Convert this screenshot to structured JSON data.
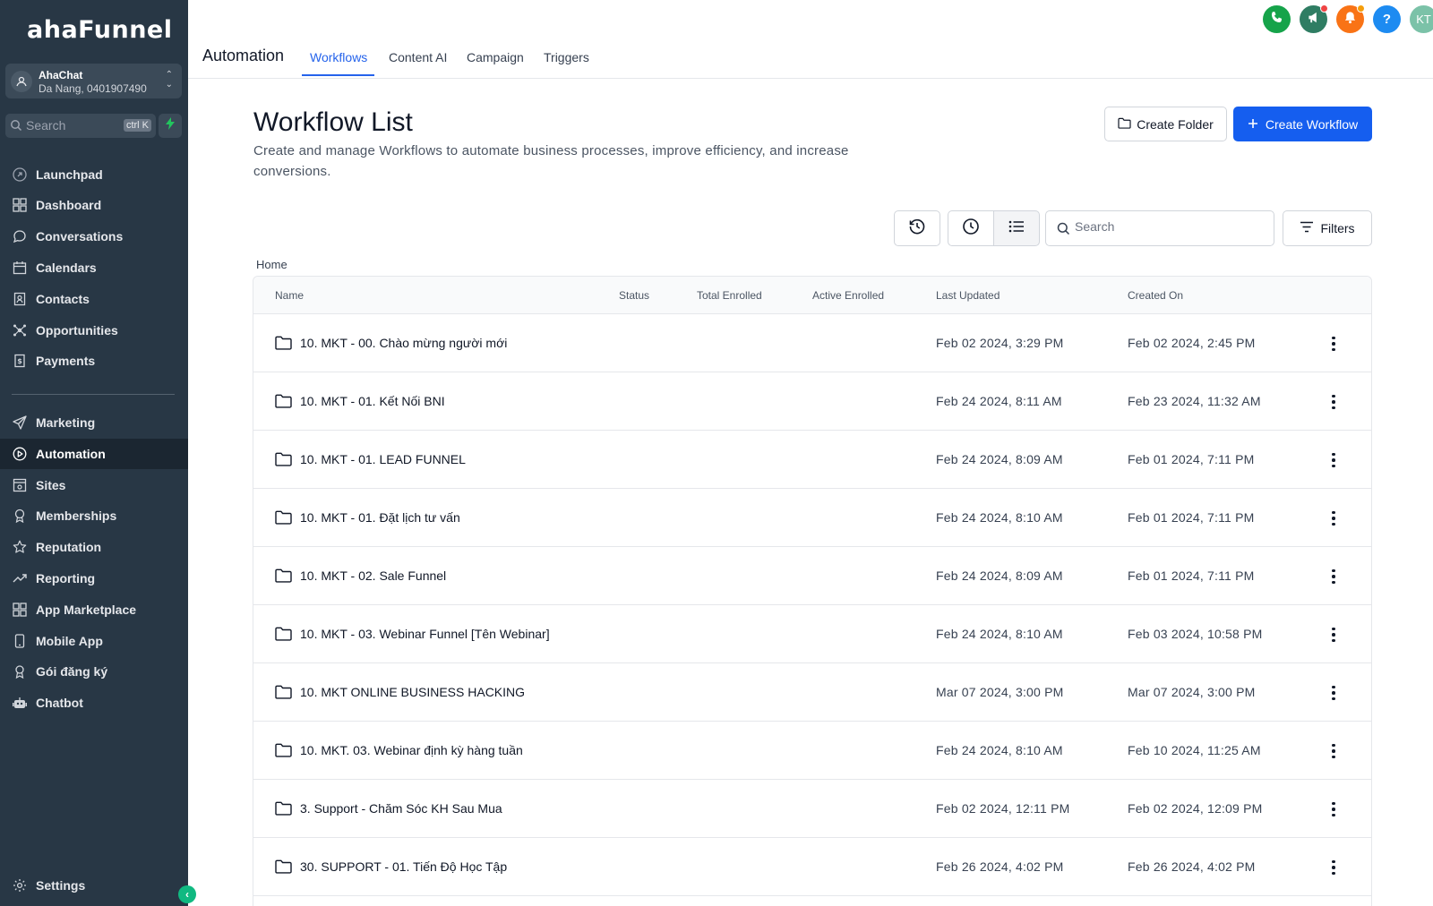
{
  "sidebar": {
    "logo": "ahaFunnel",
    "account": {
      "name": "AhaChat",
      "location": "Da Nang, 0401907490"
    },
    "search": {
      "label": "Search",
      "shortcut": "ctrl K"
    },
    "nav_primary": [
      {
        "label": "Launchpad",
        "icon": "rocket-icon"
      },
      {
        "label": "Dashboard",
        "icon": "grid-icon"
      },
      {
        "label": "Conversations",
        "icon": "chat-icon"
      },
      {
        "label": "Calendars",
        "icon": "calendar-icon"
      },
      {
        "label": "Contacts",
        "icon": "contacts-icon"
      },
      {
        "label": "Opportunities",
        "icon": "opportunities-icon"
      },
      {
        "label": "Payments",
        "icon": "payments-icon"
      }
    ],
    "nav_secondary": [
      {
        "label": "Marketing",
        "icon": "send-icon"
      },
      {
        "label": "Automation",
        "icon": "automation-icon",
        "active": true
      },
      {
        "label": "Sites",
        "icon": "sites-icon"
      },
      {
        "label": "Memberships",
        "icon": "memberships-icon"
      },
      {
        "label": "Reputation",
        "icon": "star-icon"
      },
      {
        "label": "Reporting",
        "icon": "trend-icon"
      },
      {
        "label": "App Marketplace",
        "icon": "grid-icon"
      },
      {
        "label": "Mobile App",
        "icon": "mobile-icon"
      },
      {
        "label": "Gói đăng ký",
        "icon": "badge-icon"
      },
      {
        "label": "Chatbot",
        "icon": "robot-icon"
      }
    ],
    "settings": "Settings"
  },
  "topbar": {
    "title": "Automation",
    "tabs": [
      {
        "label": "Workflows",
        "active": true
      },
      {
        "label": "Content AI"
      },
      {
        "label": "Campaign"
      },
      {
        "label": "Triggers"
      }
    ],
    "user_initials": "KT",
    "colors": {
      "phone": "#16a34a",
      "megaphone": "#2f7d63",
      "bell": "#f97316",
      "help": "#1d8bf1",
      "avatar": "#7bc2a8"
    }
  },
  "main": {
    "title": "Workflow List",
    "description": "Create and manage Workflows to automate business processes, improve efficiency, and increase conversions.",
    "create_folder": "Create Folder",
    "create_workflow": "Create Workflow",
    "search_placeholder": "Search",
    "filters": "Filters",
    "breadcrumb": "Home",
    "columns": {
      "name": "Name",
      "status": "Status",
      "total_enrolled": "Total Enrolled",
      "active_enrolled": "Active Enrolled",
      "last_updated": "Last Updated",
      "created_on": "Created On"
    },
    "rows": [
      {
        "name": "10. MKT - 00. Chào mừng người mới",
        "last_updated": "Feb 02 2024, 3:29 PM",
        "created_on": "Feb 02 2024, 2:45 PM"
      },
      {
        "name": "10. MKT - 01. Kết Nối BNI",
        "last_updated": "Feb 24 2024, 8:11 AM",
        "created_on": "Feb 23 2024, 11:32 AM"
      },
      {
        "name": "10. MKT - 01. LEAD FUNNEL",
        "last_updated": "Feb 24 2024, 8:09 AM",
        "created_on": "Feb 01 2024, 7:11 PM"
      },
      {
        "name": "10. MKT - 01. Đặt lịch tư vấn",
        "last_updated": "Feb 24 2024, 8:10 AM",
        "created_on": "Feb 01 2024, 7:11 PM"
      },
      {
        "name": "10. MKT - 02. Sale Funnel",
        "last_updated": "Feb 24 2024, 8:09 AM",
        "created_on": "Feb 01 2024, 7:11 PM"
      },
      {
        "name": "10. MKT - 03. Webinar Funnel [Tên Webinar]",
        "last_updated": "Feb 24 2024, 8:10 AM",
        "created_on": "Feb 03 2024, 10:58 PM"
      },
      {
        "name": "10. MKT ONLINE BUSINESS HACKING",
        "last_updated": "Mar 07 2024, 3:00 PM",
        "created_on": "Mar 07 2024, 3:00 PM"
      },
      {
        "name": "10. MKT. 03. Webinar định kỳ hàng tuần",
        "last_updated": "Feb 24 2024, 8:10 AM",
        "created_on": "Feb 10 2024, 11:25 AM"
      },
      {
        "name": "3. Support - Chăm Sóc KH Sau Mua",
        "last_updated": "Feb 02 2024, 12:11 PM",
        "created_on": "Feb 02 2024, 12:09 PM"
      },
      {
        "name": "30. SUPPORT - 01. Tiến Độ Học Tập",
        "last_updated": "Feb 26 2024, 4:02 PM",
        "created_on": "Feb 26 2024, 4:02 PM"
      }
    ]
  },
  "colors": {
    "accent": "#155eef",
    "sidebar_bg": "#283745",
    "sidebar_active": "#1b2631"
  }
}
